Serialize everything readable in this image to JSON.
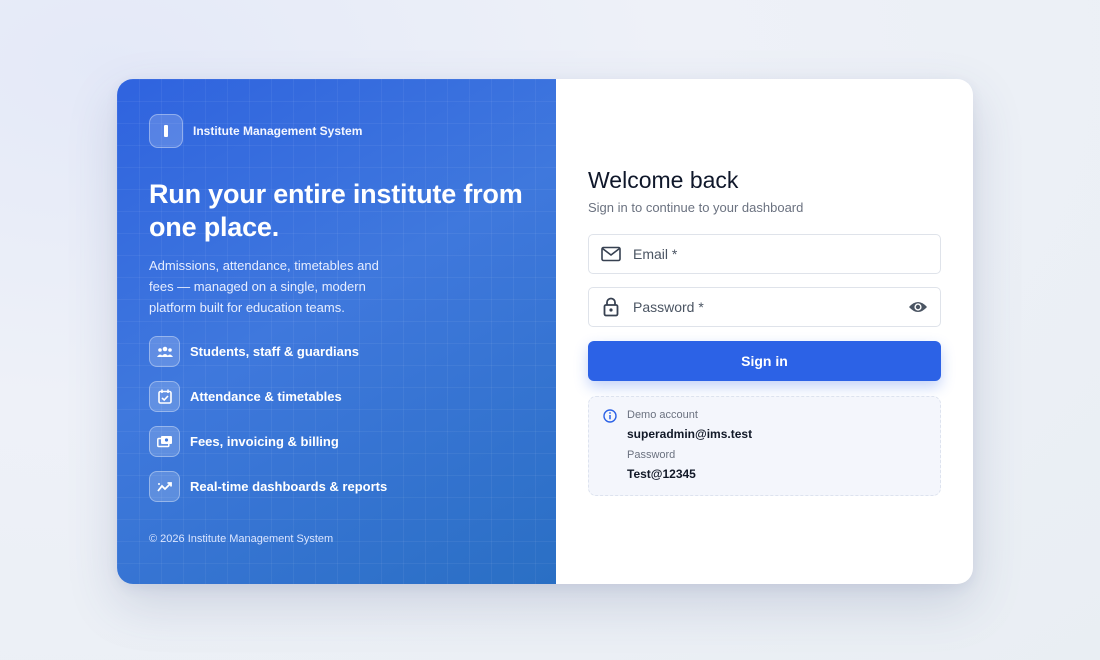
{
  "brand": {
    "name": "Institute Management System"
  },
  "hero": {
    "headline": "Run your entire institute from one place.",
    "description": "Admissions, attendance, timetables and fees — managed on a single, modern platform built for education teams."
  },
  "features": [
    {
      "icon": "people-icon",
      "label": "Students, staff & guardians"
    },
    {
      "icon": "calendar-check-icon",
      "label": "Attendance & timetables"
    },
    {
      "icon": "payments-icon",
      "label": "Fees, invoicing & billing"
    },
    {
      "icon": "trending-chart-icon",
      "label": "Real-time dashboards & reports"
    }
  ],
  "footer": {
    "copyright": "© 2026 Institute Management System"
  },
  "login": {
    "title": "Welcome back",
    "subtitle": "Sign in to continue to your dashboard",
    "email_label": "Email *",
    "password_label": "Password *",
    "submit_label": "Sign in"
  },
  "demo": {
    "title": "Demo account",
    "email": "superadmin@ims.test",
    "password_label": "Password",
    "password": "Test@12345"
  },
  "colors": {
    "primary": "#2c62e6",
    "panel_gradient_start": "#2f63df",
    "panel_gradient_end": "#2a6fc4"
  }
}
